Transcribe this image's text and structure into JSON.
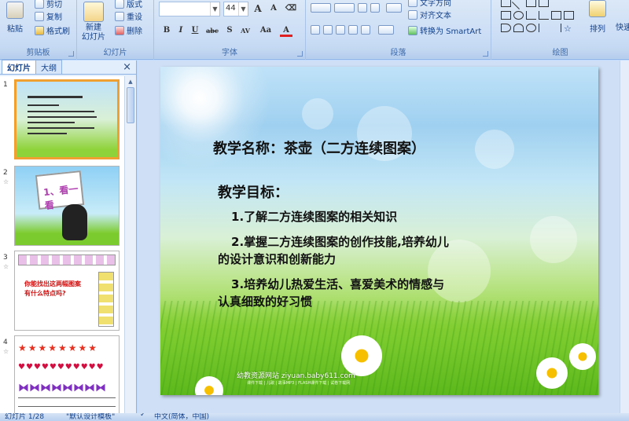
{
  "ribbon": {
    "clipboard": {
      "paste": "粘贴",
      "cut": "剪切",
      "copy": "复制",
      "format_painter": "格式刷",
      "label": "剪贴板"
    },
    "slides": {
      "new_slide_line1": "新建",
      "new_slide_line2": "幻灯片",
      "layout": "版式",
      "reset": "重设",
      "delete": "删除",
      "label": "幻灯片"
    },
    "font": {
      "size": "44",
      "grow": "A",
      "shrink": "A",
      "bold": "B",
      "italic": "I",
      "underline": "U",
      "strike": "abc",
      "shadow": "S",
      "spacing": "AV",
      "case": "Aa",
      "color": "A",
      "label": "字体"
    },
    "paragraph": {
      "text_direction": "文字方向",
      "align_text": "对齐文本",
      "smartart": "转换为 SmartArt",
      "label": "段落"
    },
    "drawing": {
      "arrange": "排列",
      "quick_styles": "快速",
      "label": "绘图"
    }
  },
  "panel": {
    "tab_slides": "幻灯片",
    "tab_outline": "大纲",
    "close": "×",
    "thumbs": [
      {
        "num": "1"
      },
      {
        "num": "2",
        "text": "1、看一看"
      },
      {
        "num": "3",
        "text": "你能找出这两幅图案有什么特点吗?"
      },
      {
        "num": "4"
      }
    ]
  },
  "slide": {
    "title": "教学名称：茶壶（二方连续图案）",
    "goal_heading": "教学目标：",
    "items": [
      {
        "num": "1",
        "text": ".了解二方连续图案的相关知识"
      },
      {
        "num": "2",
        "text": ".掌握二方连续图案的创作技能,培养幼儿",
        "text2": "的设计意识和创新能力"
      },
      {
        "num": "3",
        "text": ".培养幼儿热爱生活、喜爱美术的情感与",
        "text2": "认真细致的好习惯"
      }
    ],
    "footer": "幼教资源网站  ziyuan.baby611.com",
    "footer_small": "课件下载 | 儿歌 | 故事MP3 | FLASH课件下载 | 试卷下载网"
  },
  "status": {
    "slide_count": "幻灯片 1/28",
    "theme": "\"默认设计模板\"",
    "language": "中文(简体，中国)"
  },
  "colors": {
    "selected_thumb_border": "#f0a030",
    "ribbon_bg": "#c9dcf5"
  }
}
